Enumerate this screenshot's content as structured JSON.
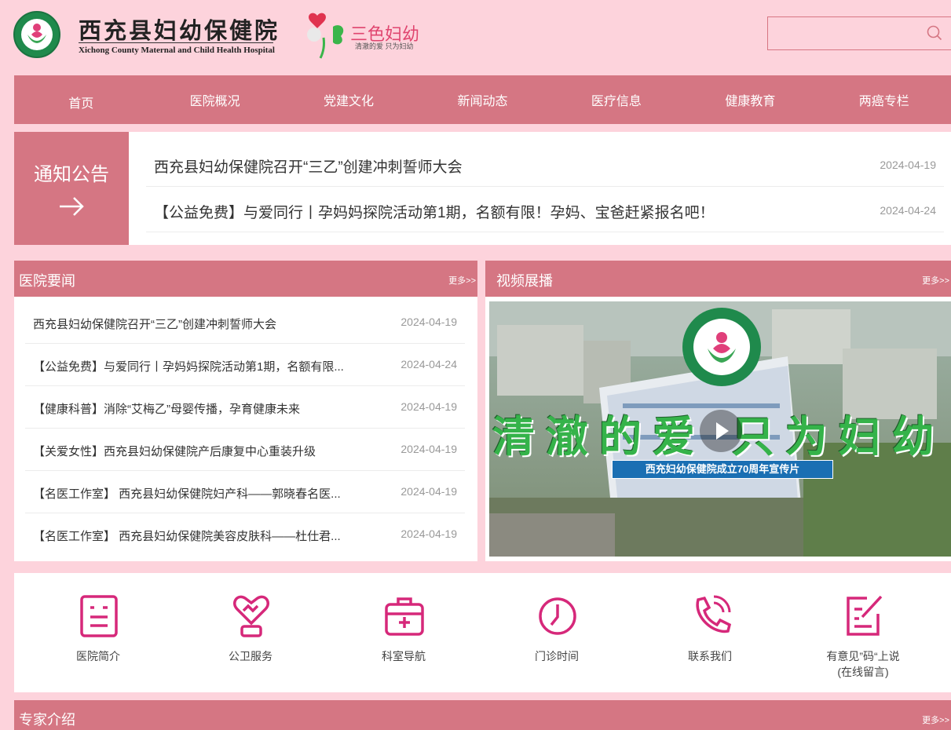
{
  "header": {
    "title": "西充县妇幼保健院",
    "subtitle": "Xichong County Maternal and Child Health Hospital",
    "brand_name": "三色妇幼",
    "brand_slogan": "清澈的爱 只为妇幼",
    "search": {
      "placeholder": ""
    }
  },
  "nav": {
    "items": [
      {
        "label": "首页"
      },
      {
        "label": "医院概况"
      },
      {
        "label": "党建文化"
      },
      {
        "label": "新闻动态"
      },
      {
        "label": "医疗信息"
      },
      {
        "label": "健康教育"
      },
      {
        "label": "两癌专栏"
      }
    ]
  },
  "notice": {
    "tag": "通知公告",
    "items": [
      {
        "title": "西充县妇幼保健院召开“三乙”创建冲刺誓师大会",
        "date": "2024-04-19"
      },
      {
        "title": "【公益免费】与爱同行丨孕妈妈探院活动第1期，名额有限！孕妈、宝爸赶紧报名吧！",
        "date": "2024-04-24"
      }
    ]
  },
  "news": {
    "title": "医院要闻",
    "more": "更多>>",
    "items": [
      {
        "title": "西充县妇幼保健院召开“三乙”创建冲刺誓师大会",
        "date": "2024-04-19"
      },
      {
        "title": "【公益免费】与爱同行丨孕妈妈探院活动第1期，名额有限...",
        "date": "2024-04-24"
      },
      {
        "title": "【健康科普】消除“艾梅乙”母婴传播，孕育健康未来",
        "date": "2024-04-19"
      },
      {
        "title": "【关爱女性】西充县妇幼保健院产后康复中心重装升级",
        "date": "2024-04-19"
      },
      {
        "title": "【名医工作室】 西充县妇幼保健院妇产科——郭晓春名医...",
        "date": "2024-04-19"
      },
      {
        "title": "【名医工作室】 西充县妇幼保健院美容皮肤科——杜仕君...",
        "date": "2024-04-19"
      }
    ]
  },
  "video": {
    "title": "视频展播",
    "more": "更多>>",
    "overlay_text": "清澈的爱 只为妇幼",
    "banner": "西充妇幼保健院成立70周年宣传片"
  },
  "quick_links": [
    {
      "label": "医院简介",
      "icon": "document-icon"
    },
    {
      "label": "公卫服务",
      "icon": "heart-hand-icon"
    },
    {
      "label": "科室导航",
      "icon": "medical-kit-icon"
    },
    {
      "label": "门诊时间",
      "icon": "clock-icon"
    },
    {
      "label": "联系我们",
      "icon": "phone-icon"
    },
    {
      "label": "有意见”码“上说\n(在线留言)",
      "icon": "edit-icon"
    }
  ],
  "expert": {
    "title": "专家介绍",
    "more": "更多>>"
  },
  "colors": {
    "background": "#fdd3dc",
    "accent": "#d57683",
    "icon": "#d6287a"
  }
}
